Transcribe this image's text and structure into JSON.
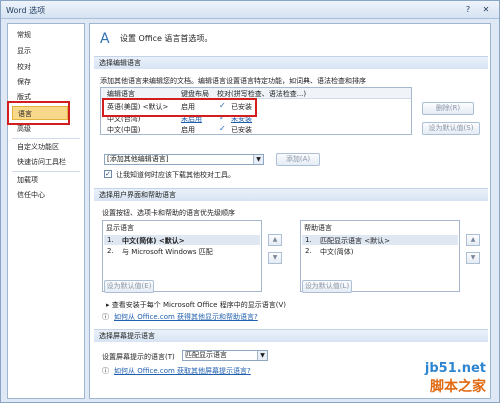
{
  "window": {
    "title": "Word 选项",
    "help": "?",
    "close": "✕"
  },
  "nav": {
    "items": [
      "常规",
      "显示",
      "校对",
      "保存",
      "版式",
      "语言",
      "高级",
      "自定义功能区",
      "快速访问工具栏",
      "加载项",
      "信任中心"
    ],
    "active_index": 5
  },
  "header": {
    "text": "设置 Office 语言首选项。"
  },
  "editing": {
    "section_title": "选择编辑语言",
    "description": "添加其他语言来编辑您的文档。编辑语言设置语言特定功能，如词典、语法检查和排序",
    "columns": [
      "编辑语言",
      "键盘布局",
      "校对(拼写检查、语法检查...)"
    ],
    "rows": [
      {
        "language": "英语(美国) <默认>",
        "keyboard": "启用",
        "proofing": "已安装"
      },
      {
        "language": "中文(台湾)",
        "keyboard": "未启用",
        "proofing": "未安装"
      },
      {
        "language": "中文(中国)",
        "keyboard": "启用",
        "proofing": "已安装"
      }
    ],
    "remove_button": "删除(R)",
    "set_default_button": "设为默认值(S)",
    "add_select": "[添加其他编辑语言]",
    "add_button": "添加(A)",
    "checkbox_label": "让我知道何时应该下载其他校对工具。"
  },
  "ui_lang": {
    "section_title": "选择用户界面和帮助语言",
    "description": "设置按钮、选项卡和帮助的语言优先级顺序",
    "display": {
      "title": "显示语言",
      "items": [
        {
          "num": "1.",
          "name": "中文(简体) <默认>"
        },
        {
          "num": "2.",
          "name": "与 Microsoft Windows 匹配"
        }
      ],
      "default_button": "设为默认值(E)"
    },
    "help": {
      "title": "帮助语言",
      "items": [
        {
          "num": "1.",
          "name": "匹配显示语言 <默认>"
        },
        {
          "num": "2.",
          "name": "中文(简体)"
        }
      ],
      "default_button": "设为默认值(L)"
    },
    "view_link_text": "查看安装于每个 Microsoft Office 程序中的显示语言(V)",
    "more_link": "如何从 Office.com 获得其他显示和帮助语言?"
  },
  "screentip": {
    "section_title": "选择屏幕提示语言",
    "label": "设置屏幕提示的语言(T)",
    "select": "匹配显示语言",
    "link": "如何从 Office.com 获取其他屏幕提示语言?"
  },
  "watermark": {
    "line1": "jb51.net",
    "line2": "脚本之家"
  }
}
